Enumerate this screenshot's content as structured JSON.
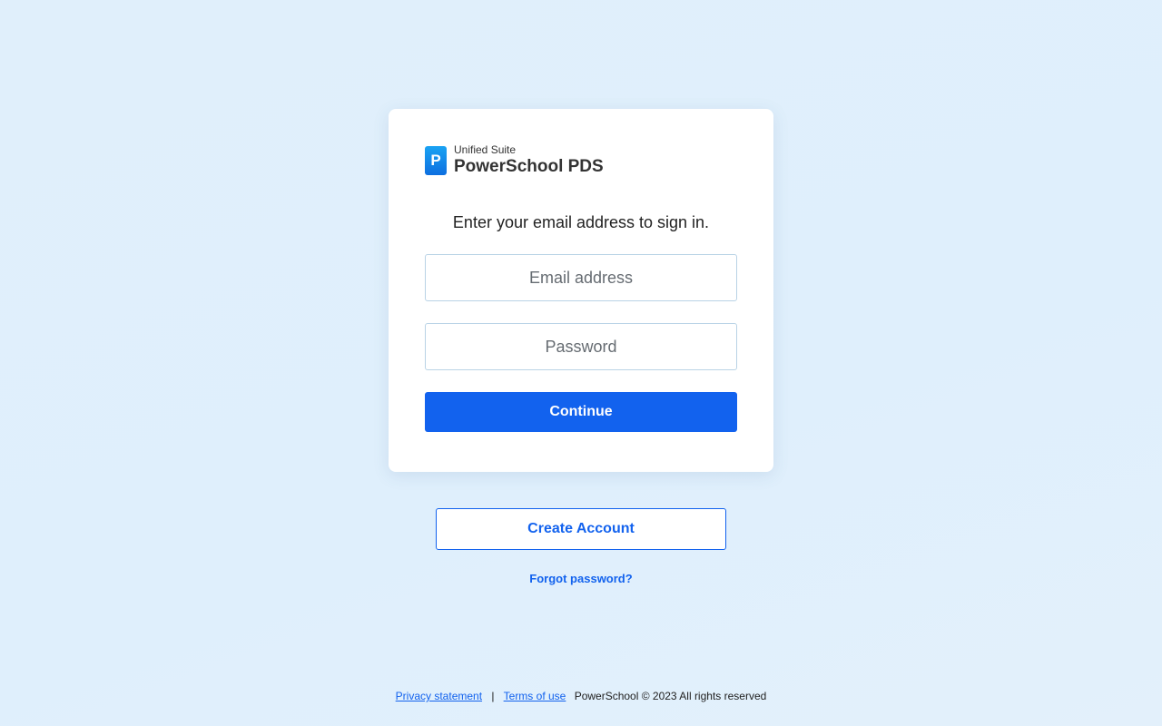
{
  "brand": {
    "logo_letter": "P",
    "suite": "Unified Suite",
    "product": "PowerSchool PDS"
  },
  "signin": {
    "prompt": "Enter your email address to sign in.",
    "email_placeholder": "Email address",
    "password_placeholder": "Password",
    "continue_label": "Continue"
  },
  "create_account_label": "Create Account",
  "forgot_password_label": "Forgot password?",
  "footer": {
    "privacy": "Privacy statement",
    "separator": "|",
    "terms": "Terms of use",
    "copyright": "PowerSchool © 2023 All rights reserved"
  },
  "colors": {
    "primary": "#1262ee",
    "background": "#e0effb",
    "card": "#ffffff"
  }
}
